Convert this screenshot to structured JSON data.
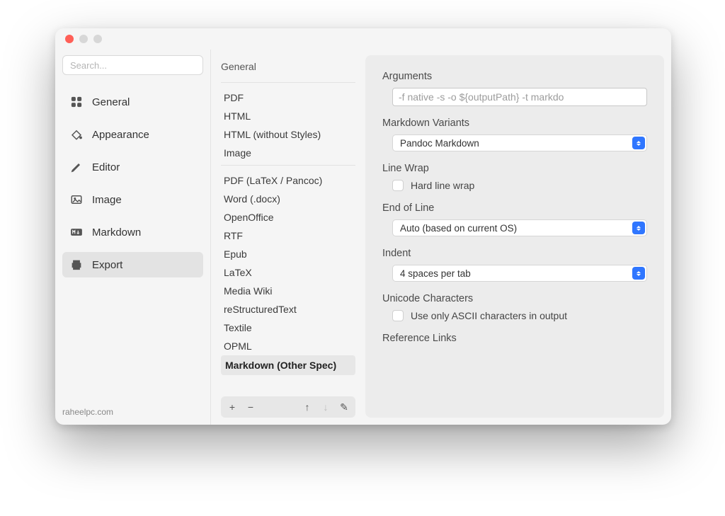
{
  "sidebar": {
    "search_placeholder": "Search...",
    "items": [
      {
        "key": "general",
        "label": "General",
        "icon": "grid-icon",
        "selected": false
      },
      {
        "key": "appearance",
        "label": "Appearance",
        "icon": "paint-bucket-icon",
        "selected": false
      },
      {
        "key": "editor",
        "label": "Editor",
        "icon": "pencil-icon",
        "selected": false
      },
      {
        "key": "image",
        "label": "Image",
        "icon": "image-icon",
        "selected": false
      },
      {
        "key": "markdown",
        "label": "Markdown",
        "icon": "markdown-icon",
        "selected": false
      },
      {
        "key": "export",
        "label": "Export",
        "icon": "printer-icon",
        "selected": true
      }
    ]
  },
  "export_list": {
    "heading": "General",
    "group1": [
      "PDF",
      "HTML",
      "HTML (without Styles)",
      "Image"
    ],
    "group2": [
      "PDF (LaTeX / Pancoc)",
      "Word (.docx)",
      "OpenOffice",
      "RTF",
      "Epub",
      "LaTeX",
      "Media Wiki",
      "reStructuredText",
      "Textile",
      "OPML"
    ],
    "selected": "Markdown (Other Spec)",
    "toolbar": {
      "add": "+",
      "remove": "−",
      "up": "↑",
      "down": "↓",
      "edit": "✎"
    }
  },
  "detail": {
    "arguments_label": "Arguments",
    "arguments_placeholder": "-f native -s -o ${outputPath} -t markdo",
    "variants_label": "Markdown Variants",
    "variants_value": "Pandoc Markdown",
    "linewrap_label": "Line Wrap",
    "linewrap_checkbox": "Hard line wrap",
    "eol_label": "End of Line",
    "eol_value": "Auto (based on current OS)",
    "indent_label": "Indent",
    "indent_value": "4 spaces per tab",
    "unicode_label": "Unicode Characters",
    "unicode_checkbox": "Use only ASCII characters in output",
    "reflinks_label": "Reference Links"
  },
  "watermark": "raheelpc.com"
}
